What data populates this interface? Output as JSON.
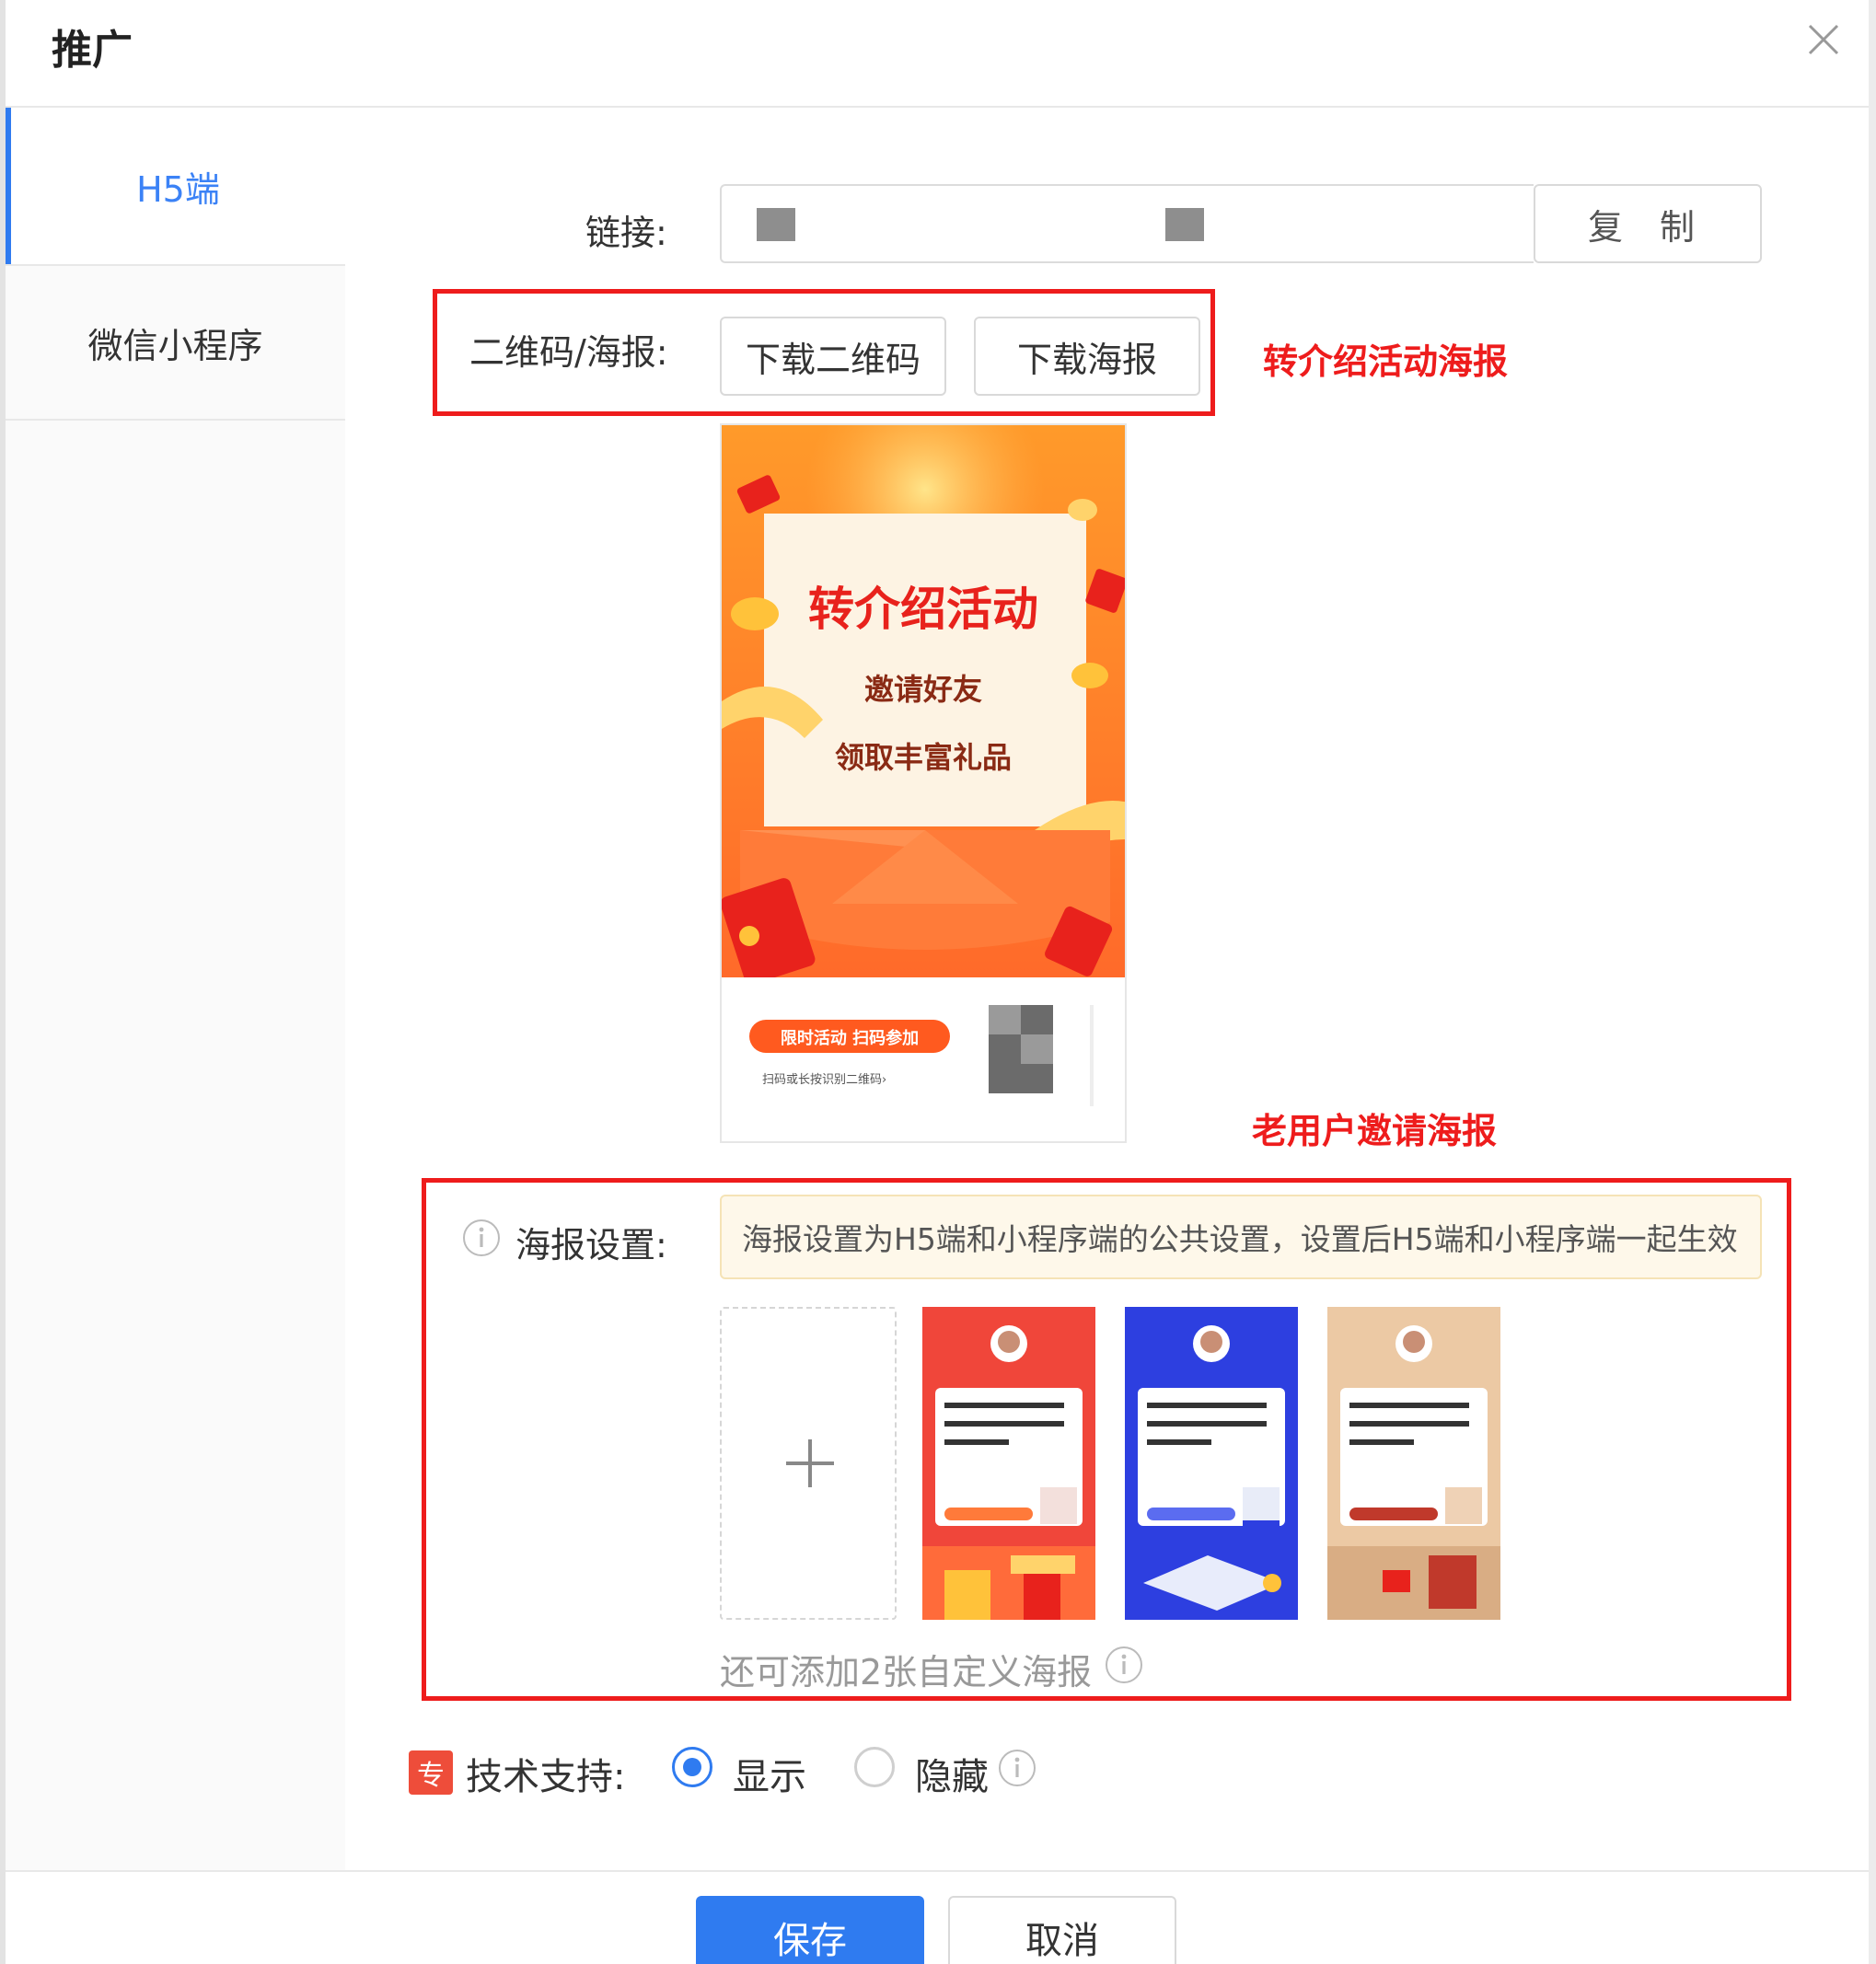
{
  "header": {
    "title": "推广",
    "close_icon": "close-icon"
  },
  "sidebar": {
    "items": [
      {
        "label": "H5端",
        "active": true
      },
      {
        "label": "微信小程序",
        "active": false
      }
    ]
  },
  "link_row": {
    "label": "链接:",
    "copy_label": "复 制"
  },
  "qr_row": {
    "label": "二维码/海报:",
    "download_qr_label": "下载二维码",
    "download_poster_label": "下载海报",
    "annotation": "转介绍活动海报"
  },
  "poster_preview": {
    "title": "转介绍活动",
    "line1": "邀请好友",
    "line2": "领取丰富礼品",
    "pill_text": "限时活动 扫码参加",
    "small_text": "扫码或长按识别二维码›"
  },
  "poster_settings": {
    "annotation": "老用户邀请海报",
    "label": "海报设置:",
    "hint": "海报设置为H5端和小程序端的公共设置，设置后H5端和小程序端一起生效",
    "add_more_text": "还可添加2张自定义海报",
    "templates": [
      {
        "name": "red",
        "color": "#f0463a"
      },
      {
        "name": "blue",
        "color": "#2d3fe0"
      },
      {
        "name": "beige",
        "color": "#ecc9a4"
      }
    ]
  },
  "tech_support": {
    "badge": "专",
    "label": "技术支持:",
    "options": [
      {
        "label": "显示",
        "selected": true
      },
      {
        "label": "隐藏",
        "selected": false
      }
    ]
  },
  "footer": {
    "save_label": "保存",
    "cancel_label": "取消"
  },
  "colors": {
    "primary": "#2f7bf0",
    "annotation_red": "#ee1c1c",
    "hint_bg": "#fef8ea"
  }
}
